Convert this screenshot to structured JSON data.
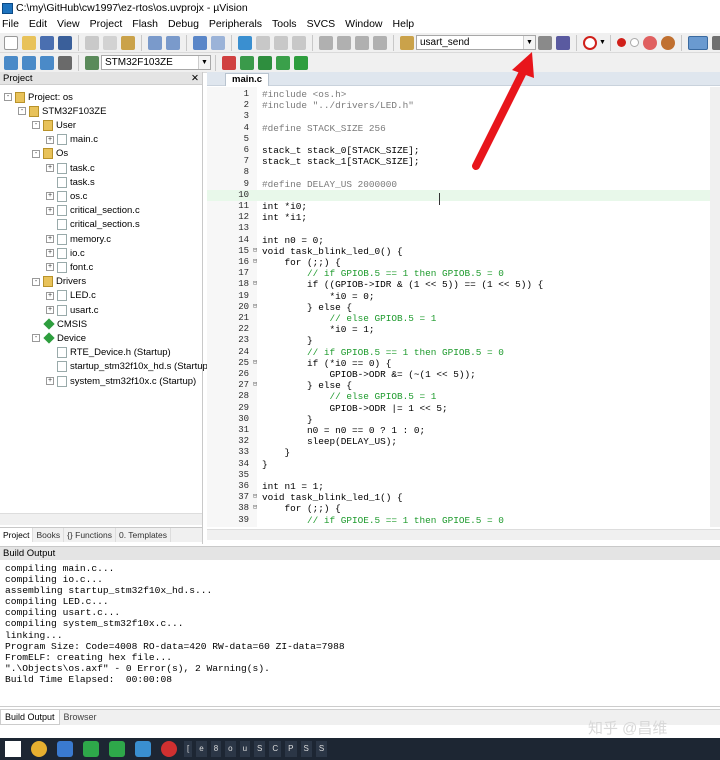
{
  "window": {
    "title": "C:\\my\\GitHub\\cw1997\\ez-rtos\\os.uvprojx - µVision"
  },
  "menu": [
    "File",
    "Edit",
    "View",
    "Project",
    "Flash",
    "Debug",
    "Peripherals",
    "Tools",
    "SVCS",
    "Window",
    "Help"
  ],
  "toolbar": {
    "target_combo": "usart_send",
    "target_select": "STM32F103ZE"
  },
  "project_panel": {
    "title": "Project",
    "tree": [
      {
        "label": "Project: os",
        "level": 0,
        "toggle": "-",
        "icon": "project"
      },
      {
        "label": "STM32F103ZE",
        "level": 1,
        "toggle": "-",
        "icon": "target"
      },
      {
        "label": "User",
        "level": 2,
        "toggle": "-",
        "icon": "folder"
      },
      {
        "label": "main.c",
        "level": 3,
        "toggle": "+",
        "icon": "file"
      },
      {
        "label": "Os",
        "level": 2,
        "toggle": "-",
        "icon": "folder"
      },
      {
        "label": "task.c",
        "level": 3,
        "toggle": "+",
        "icon": "file"
      },
      {
        "label": "task.s",
        "level": 3,
        "toggle": "",
        "icon": "file"
      },
      {
        "label": "os.c",
        "level": 3,
        "toggle": "+",
        "icon": "file"
      },
      {
        "label": "critical_section.c",
        "level": 3,
        "toggle": "+",
        "icon": "file"
      },
      {
        "label": "critical_section.s",
        "level": 3,
        "toggle": "",
        "icon": "file"
      },
      {
        "label": "memory.c",
        "level": 3,
        "toggle": "+",
        "icon": "file"
      },
      {
        "label": "io.c",
        "level": 3,
        "toggle": "+",
        "icon": "file"
      },
      {
        "label": "font.c",
        "level": 3,
        "toggle": "+",
        "icon": "file"
      },
      {
        "label": "Drivers",
        "level": 2,
        "toggle": "-",
        "icon": "folder"
      },
      {
        "label": "LED.c",
        "level": 3,
        "toggle": "+",
        "icon": "file"
      },
      {
        "label": "usart.c",
        "level": 3,
        "toggle": "+",
        "icon": "file"
      },
      {
        "label": "CMSIS",
        "level": 2,
        "toggle": "",
        "icon": "green"
      },
      {
        "label": "Device",
        "level": 2,
        "toggle": "-",
        "icon": "green"
      },
      {
        "label": "RTE_Device.h (Startup)",
        "level": 3,
        "toggle": "",
        "icon": "file"
      },
      {
        "label": "startup_stm32f10x_hd.s (Startup)",
        "level": 3,
        "toggle": "",
        "icon": "file"
      },
      {
        "label": "system_stm32f10x.c (Startup)",
        "level": 3,
        "toggle": "+",
        "icon": "file"
      }
    ],
    "tabs": [
      "Project",
      "Books",
      "{} Functions",
      "0. Templates"
    ]
  },
  "editor": {
    "tab": "main.c",
    "lines": [
      {
        "n": "1",
        "f": "",
        "t": "#include <os.h>",
        "c": "pp"
      },
      {
        "n": "2",
        "f": "",
        "t": "#include \"../drivers/LED.h\"",
        "c": "pp"
      },
      {
        "n": "3",
        "f": "",
        "t": "",
        "c": ""
      },
      {
        "n": "4",
        "f": "",
        "t": "#define STACK_SIZE 256",
        "c": "pp"
      },
      {
        "n": "5",
        "f": "",
        "t": "",
        "c": ""
      },
      {
        "n": "6",
        "f": "",
        "t": "stack_t stack_0[STACK_SIZE];",
        "c": ""
      },
      {
        "n": "7",
        "f": "",
        "t": "stack_t stack_1[STACK_SIZE];",
        "c": ""
      },
      {
        "n": "8",
        "f": "",
        "t": "",
        "c": ""
      },
      {
        "n": "9",
        "f": "",
        "t": "#define DELAY_US 2000000",
        "c": "pp"
      },
      {
        "n": "10",
        "f": "",
        "t": "",
        "c": "cur"
      },
      {
        "n": "11",
        "f": "",
        "t": "int *i0;",
        "c": ""
      },
      {
        "n": "12",
        "f": "",
        "t": "int *i1;",
        "c": ""
      },
      {
        "n": "13",
        "f": "",
        "t": "",
        "c": ""
      },
      {
        "n": "14",
        "f": "",
        "t": "int n0 = 0;",
        "c": ""
      },
      {
        "n": "15",
        "f": "-",
        "t": "void task_blink_led_0() {",
        "c": ""
      },
      {
        "n": "16",
        "f": "-",
        "t": "    for (;;) {",
        "c": ""
      },
      {
        "n": "17",
        "f": "",
        "t": "        // if GPIOB.5 == 1 then GPIOB.5 = 0",
        "c": "cm"
      },
      {
        "n": "18",
        "f": "-",
        "t": "        if ((GPIOB->IDR & (1 << 5)) == (1 << 5)) {",
        "c": ""
      },
      {
        "n": "19",
        "f": "",
        "t": "            *i0 = 0;",
        "c": ""
      },
      {
        "n": "20",
        "f": "-",
        "t": "        } else {",
        "c": ""
      },
      {
        "n": "21",
        "f": "",
        "t": "            // else GPIOB.5 = 1",
        "c": "cm"
      },
      {
        "n": "22",
        "f": "",
        "t": "            *i0 = 1;",
        "c": ""
      },
      {
        "n": "23",
        "f": "",
        "t": "        }",
        "c": ""
      },
      {
        "n": "24",
        "f": "",
        "t": "        // if GPIOB.5 == 1 then GPIOB.5 = 0",
        "c": "cm"
      },
      {
        "n": "25",
        "f": "-",
        "t": "        if (*i0 == 0) {",
        "c": ""
      },
      {
        "n": "26",
        "f": "",
        "t": "            GPIOB->ODR &= (~(1 << 5));",
        "c": ""
      },
      {
        "n": "27",
        "f": "-",
        "t": "        } else {",
        "c": ""
      },
      {
        "n": "28",
        "f": "",
        "t": "            // else GPIOB.5 = 1",
        "c": "cm"
      },
      {
        "n": "29",
        "f": "",
        "t": "            GPIOB->ODR |= 1 << 5;",
        "c": ""
      },
      {
        "n": "30",
        "f": "",
        "t": "        }",
        "c": ""
      },
      {
        "n": "31",
        "f": "",
        "t": "        n0 = n0 == 0 ? 1 : 0;",
        "c": ""
      },
      {
        "n": "32",
        "f": "",
        "t": "        sleep(DELAY_US);",
        "c": ""
      },
      {
        "n": "33",
        "f": "",
        "t": "    }",
        "c": ""
      },
      {
        "n": "34",
        "f": "",
        "t": "}",
        "c": ""
      },
      {
        "n": "35",
        "f": "",
        "t": "",
        "c": ""
      },
      {
        "n": "36",
        "f": "",
        "t": "int n1 = 1;",
        "c": ""
      },
      {
        "n": "37",
        "f": "-",
        "t": "void task_blink_led_1() {",
        "c": ""
      },
      {
        "n": "38",
        "f": "-",
        "t": "    for (;;) {",
        "c": ""
      },
      {
        "n": "39",
        "f": "",
        "t": "        // if GPIOE.5 == 1 then GPIOE.5 = 0",
        "c": "cm"
      }
    ]
  },
  "build": {
    "title": "Build Output",
    "lines": [
      "compiling main.c...",
      "compiling io.c...",
      "assembling startup_stm32f10x_hd.s...",
      "compiling LED.c...",
      "compiling usart.c...",
      "compiling system_stm32f10x.c...",
      "linking...",
      "Program Size: Code=4008 RO-data=420 RW-data=60 ZI-data=7988",
      "FromELF: creating hex file...",
      "\".\\Objects\\os.axf\" - 0 Error(s), 2 Warning(s).",
      "Build Time Elapsed:  00:00:08"
    ],
    "tabs": [
      "Build Output",
      "Browser"
    ]
  },
  "watermark": "知乎 @昌维",
  "taskbar": {
    "windows": [
      "[",
      "e",
      "8",
      "o",
      "u",
      "S",
      "C",
      "P",
      "S",
      "S"
    ]
  },
  "colors": {
    "arrow": "#e8151b",
    "comment": "#1f9b2e",
    "current_line": "#e8f8ea"
  }
}
